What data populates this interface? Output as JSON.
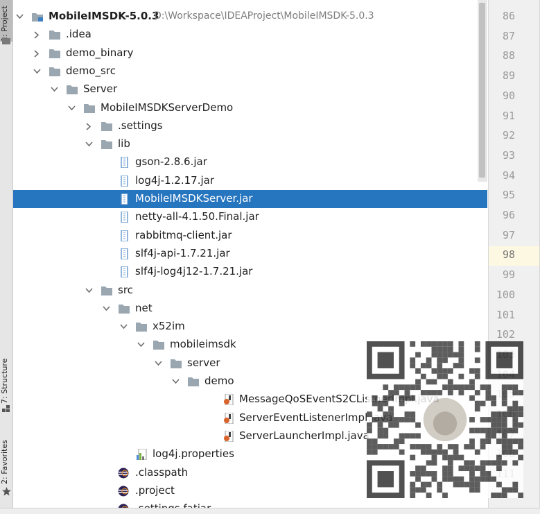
{
  "tool_strip": {
    "project_tab": "1: Project",
    "structure_tab": "7: Structure",
    "favorites_tab": "2: Favorites"
  },
  "tree": {
    "rows": [
      {
        "label": "MobileIMSDK-5.0.3",
        "path": "D:\\Workspace\\IDEAProject\\MobileIMSDK-5.0.3",
        "depth": 0,
        "arrow": "expanded",
        "icon": "module-folder-icon",
        "bold": true
      },
      {
        "label": ".idea",
        "depth": 1,
        "arrow": "collapsed",
        "icon": "folder-icon"
      },
      {
        "label": "demo_binary",
        "depth": 1,
        "arrow": "collapsed",
        "icon": "folder-icon"
      },
      {
        "label": "demo_src",
        "depth": 1,
        "arrow": "expanded",
        "icon": "folder-icon"
      },
      {
        "label": "Server",
        "depth": 2,
        "arrow": "expanded",
        "icon": "folder-icon"
      },
      {
        "label": "MobileIMSDKServerDemo",
        "depth": 3,
        "arrow": "expanded",
        "icon": "folder-icon"
      },
      {
        "label": ".settings",
        "depth": 4,
        "arrow": "collapsed",
        "icon": "folder-icon"
      },
      {
        "label": "lib",
        "depth": 4,
        "arrow": "expanded",
        "icon": "folder-icon"
      },
      {
        "label": "gson-2.8.6.jar",
        "depth": 5,
        "arrow": "none",
        "icon": "jar-icon"
      },
      {
        "label": "log4j-1.2.17.jar",
        "depth": 5,
        "arrow": "none",
        "icon": "jar-icon"
      },
      {
        "label": "MobileIMSDKServer.jar",
        "depth": 5,
        "arrow": "none",
        "icon": "jar-icon",
        "selected": true
      },
      {
        "label": "netty-all-4.1.50.Final.jar",
        "depth": 5,
        "arrow": "none",
        "icon": "jar-icon"
      },
      {
        "label": "rabbitmq-client.jar",
        "depth": 5,
        "arrow": "none",
        "icon": "jar-icon"
      },
      {
        "label": "slf4j-api-1.7.21.jar",
        "depth": 5,
        "arrow": "none",
        "icon": "jar-icon"
      },
      {
        "label": "slf4j-log4j12-1.7.21.jar",
        "depth": 5,
        "arrow": "none",
        "icon": "jar-icon"
      },
      {
        "label": "src",
        "depth": 4,
        "arrow": "expanded",
        "icon": "folder-icon"
      },
      {
        "label": "net",
        "depth": 5,
        "arrow": "expanded",
        "icon": "folder-icon"
      },
      {
        "label": "x52im",
        "depth": 6,
        "arrow": "expanded",
        "icon": "folder-icon"
      },
      {
        "label": "mobileimsdk",
        "depth": 7,
        "arrow": "expanded",
        "icon": "folder-icon"
      },
      {
        "label": "server",
        "depth": 8,
        "arrow": "expanded",
        "icon": "folder-icon"
      },
      {
        "label": "demo",
        "depth": 9,
        "arrow": "expanded",
        "icon": "folder-icon"
      },
      {
        "label": "MessageQoSEventS2CListnerImpl.java",
        "depth": 11,
        "arrow": "none",
        "icon": "java-file-icon"
      },
      {
        "label": "ServerEventListenerImpl.java",
        "depth": 11,
        "arrow": "none",
        "icon": "java-file-icon"
      },
      {
        "label": "ServerLauncherImpl.java",
        "depth": 11,
        "arrow": "none",
        "icon": "java-file-icon"
      },
      {
        "label": "log4j.properties",
        "depth": 6,
        "arrow": "none",
        "icon": "properties-file-icon"
      },
      {
        "label": ".classpath",
        "depth": 5,
        "arrow": "none",
        "icon": "eclipse-file-icon"
      },
      {
        "label": ".project",
        "depth": 5,
        "arrow": "none",
        "icon": "eclipse-file-icon"
      },
      {
        "label": ".settings.fatjar",
        "depth": 5,
        "arrow": "none",
        "icon": "eclipse-file-icon"
      }
    ]
  },
  "gutter": {
    "line_numbers": [
      "86",
      "87",
      "88",
      "89",
      "90",
      "91",
      "92",
      "93",
      "94",
      "95",
      "96",
      "97",
      "98",
      "99",
      "100",
      "101",
      "102",
      "103",
      "104",
      "105",
      "106",
      "107",
      "108",
      "111"
    ],
    "current_line": "98"
  },
  "colors": {
    "selection": "#2675bf",
    "folder": "#9aa7b0",
    "jar": "#6f9fd0",
    "java": "#d9632a",
    "current_line_bg": "#fcf8e1"
  }
}
